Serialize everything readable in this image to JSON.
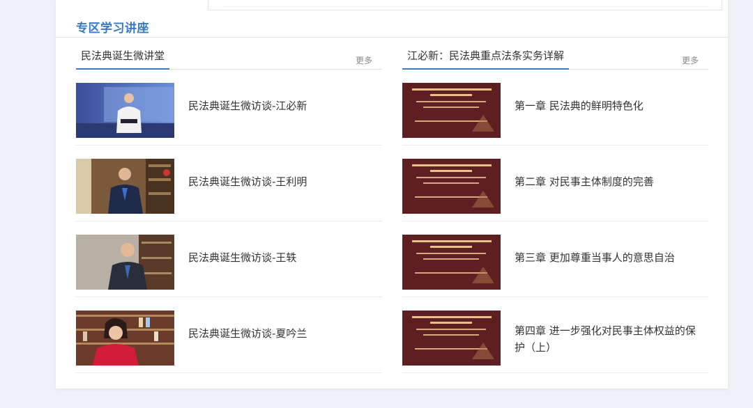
{
  "section": {
    "title": "专区学习讲座"
  },
  "left_column": {
    "title": "民法典诞生微讲堂",
    "more_label": "更多",
    "items": [
      {
        "title": "民法典诞生微访谈-江必新",
        "thumb": "speaker-stage"
      },
      {
        "title": "民法典诞生微访谈-王利明",
        "thumb": "speaker-office"
      },
      {
        "title": "民法典诞生微访谈-王轶",
        "thumb": "speaker-library"
      },
      {
        "title": "民法典诞生微访谈-夏吟兰",
        "thumb": "speaker-bookshelf"
      }
    ]
  },
  "right_column": {
    "title": "江必新：民法典重点法条实务详解",
    "more_label": "更多",
    "items": [
      {
        "title": "第一章 民法典的鲜明特色化",
        "thumb": "lecture-slide"
      },
      {
        "title": "第二章 对民事主体制度的完善",
        "thumb": "lecture-slide"
      },
      {
        "title": "第三章 更加尊重当事人的意思自治",
        "thumb": "lecture-slide"
      },
      {
        "title": "第四章 进一步强化对民事主体权益的保护（上）",
        "thumb": "lecture-slide"
      }
    ]
  },
  "colors": {
    "accent": "#3a78c3",
    "slide_bg": "#5a1f22"
  }
}
